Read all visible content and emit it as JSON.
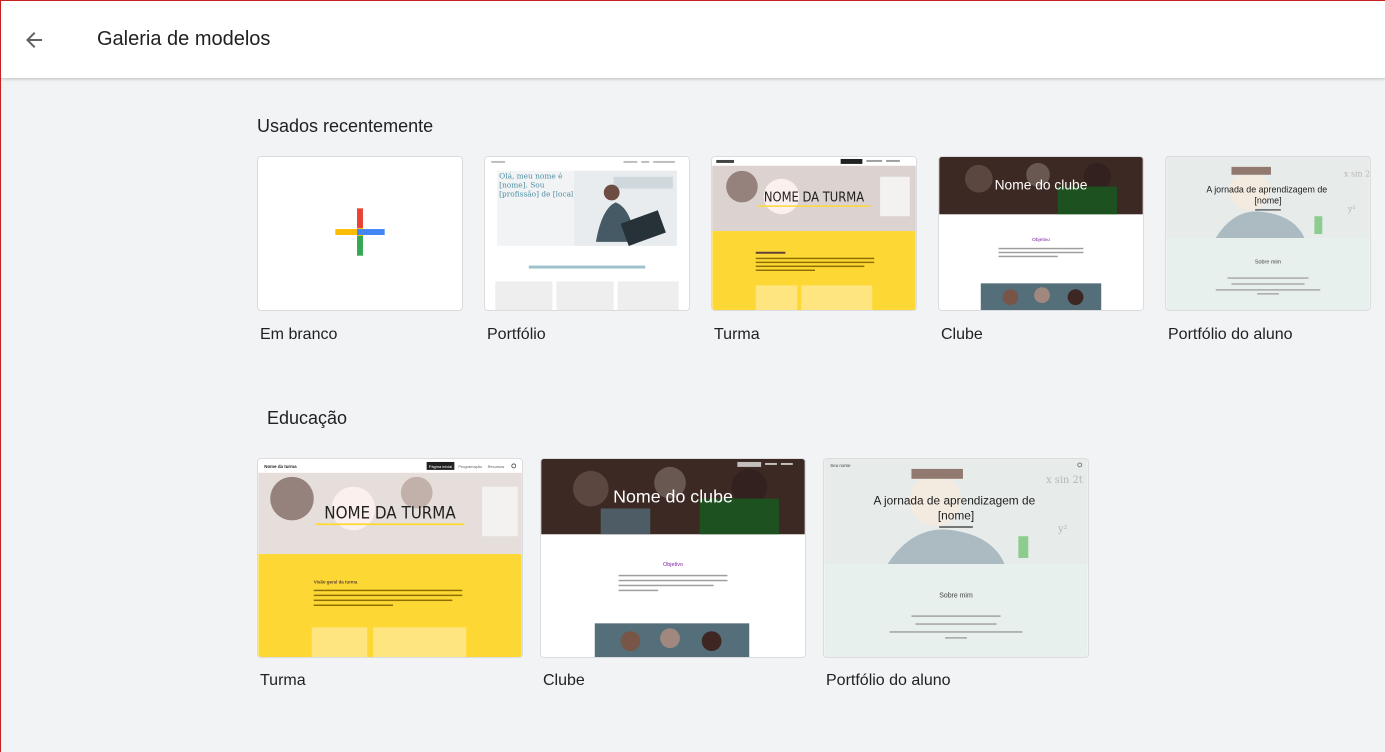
{
  "header": {
    "title": "Galeria de modelos"
  },
  "sections": {
    "recent": {
      "title": "Usados recentemente",
      "cards": [
        {
          "label": "Em branco"
        },
        {
          "label": "Portfólio"
        },
        {
          "label": "Turma"
        },
        {
          "label": "Clube"
        },
        {
          "label": "Portfólio do aluno"
        }
      ]
    },
    "education": {
      "title": "Educação",
      "cards": [
        {
          "label": "Turma"
        },
        {
          "label": "Clube"
        },
        {
          "label": "Portfólio do aluno"
        }
      ]
    }
  },
  "thumbnails": {
    "portfolio": {
      "hero_text": "Olá, meu nome é [nome]. Sou [profissão] de [local].",
      "works_label": "Trabalhos selecionados",
      "nav_items": [
        "Página inicial",
        "Sobre",
        "Fale comigo"
      ]
    },
    "turma": {
      "site_name": "Nome da turma",
      "heading": "NOME DA TURMA",
      "nav_items": [
        "Página inicial",
        "Programação",
        "Recursos"
      ],
      "section_title": "Visão geral da turma",
      "body": "Quais são os objetivos de aprendizagem da sua turma? Almeje uma descrição sobre o que os alunos vão aprender, como podem ser avaliados e o que atenderão ao final da turma."
    },
    "clube": {
      "heading": "Nome do clube",
      "objective_title": "Objetivo",
      "body": "Qual o objetivo do clube? Como pode me tornar membro ou participar de projetos? Quais são os benefícios?"
    },
    "aluno": {
      "site_name": "Seu nome",
      "heading": "A jornada de aprendizagem de [nome]",
      "about_title": "Sobre mim",
      "about_lines": [
        "Conte um pouco sobre você e seus interesses aqui.",
        "Qual é o nome da sua escola? Em que ano você está?",
        "Quais são seus hobbies, talentos e conhecimentos? Onde você gosta de aprender?"
      ]
    }
  },
  "colors": {
    "accent_yellow": "#fdd835",
    "google_blue": "#4285f4",
    "google_red": "#ea4335",
    "google_yellow": "#fbbc04",
    "google_green": "#34a853",
    "club_purple": "#7b1fa2"
  }
}
